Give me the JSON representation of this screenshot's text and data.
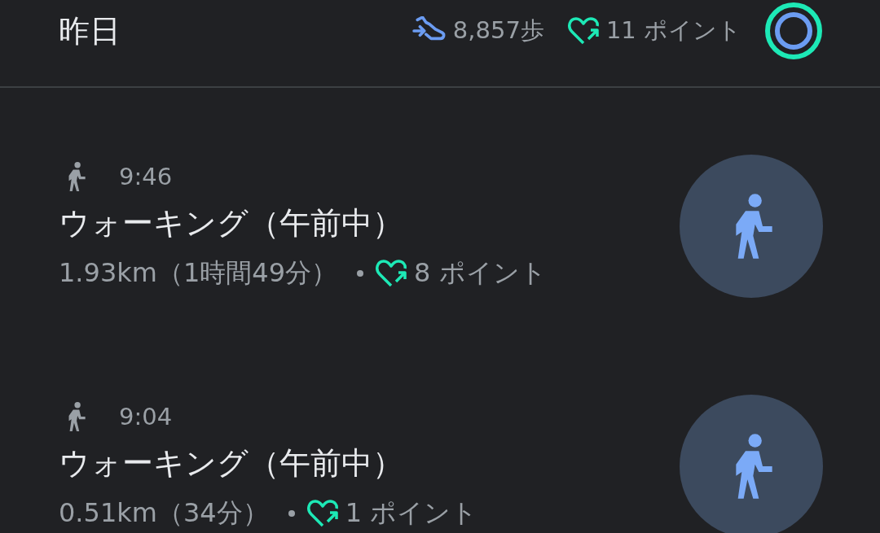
{
  "header": {
    "title": "昨日",
    "steps": "8,857歩",
    "points": "11 ポイント"
  },
  "activities": [
    {
      "time": "9:46",
      "title": "ウォーキング（午前中）",
      "detail": "1.93km（1時間49分）",
      "points": "8 ポイント"
    },
    {
      "time": "9:04",
      "title": "ウォーキング（午前中）",
      "detail": "0.51km（34分）",
      "points": "1 ポイント"
    }
  ]
}
